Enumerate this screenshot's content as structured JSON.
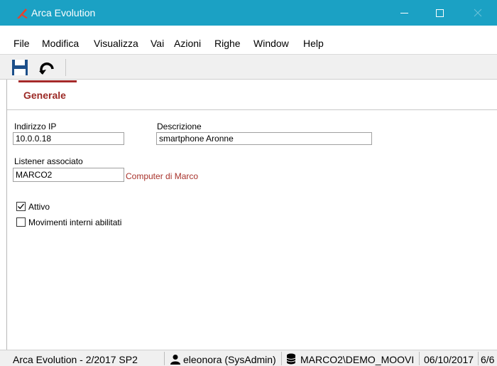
{
  "window": {
    "title": "Arca Evolution",
    "accent_color": "#1ba1c4",
    "app_icon": "arca-logo-icon"
  },
  "menu": [
    "File",
    "Modifica",
    "Visualizza",
    "Vai",
    "Azioni",
    "Righe",
    "Window",
    "Help"
  ],
  "toolbar": {
    "save_icon": "save-floppy-icon",
    "undo_icon": "undo-icon"
  },
  "tab": {
    "label": "Generale",
    "color": "#9c2a26"
  },
  "form": {
    "ip_label": "Indirizzo IP",
    "ip_value": "10.0.0.18",
    "descr_label": "Descrizione",
    "descr_value": "smartphone Aronne",
    "listener_label": "Listener associato",
    "listener_value": "MARCO2",
    "listener_desc": "Computer di Marco",
    "attivo_label": "Attivo",
    "attivo_checked": true,
    "movimenti_label": "Movimenti interni abilitati",
    "movimenti_checked": false
  },
  "status": {
    "version": "Arca Evolution - 2/2017 SP2",
    "user": "eleonora (SysAdmin)",
    "database": "MARCO2\\DEMO_MOOVI",
    "date": "06/10/2017",
    "extra": "6/6"
  }
}
